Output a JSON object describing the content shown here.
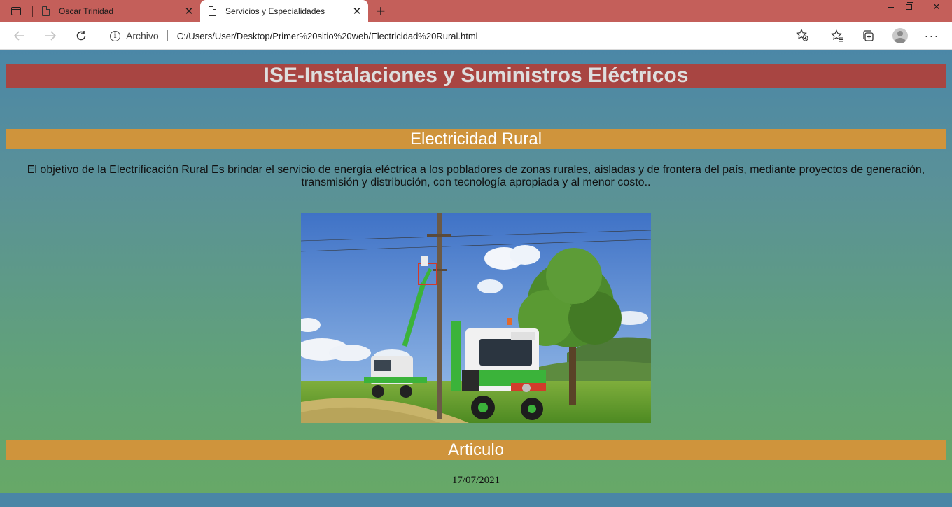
{
  "browser": {
    "tabs": [
      {
        "title": "Oscar Trinidad",
        "active": false
      },
      {
        "title": "Servicios y Especialidades",
        "active": true
      }
    ],
    "new_tab_symbol": "+",
    "address": {
      "site_label": "Archivo",
      "url": "C:/Users/User/Desktop/Primer%20sitio%20web/Electricidad%20Rural.html"
    },
    "icons": [
      "tab-actions-icon",
      "document-icon",
      "close-icon",
      "back-arrow-icon",
      "forward-arrow-icon",
      "reload-icon",
      "info-icon",
      "add-favorite-icon",
      "favorites-icon",
      "collections-icon",
      "profile-avatar",
      "more-menu-icon"
    ]
  },
  "page": {
    "header": "ISE-Instalaciones y Suministros Eléctricos",
    "section_title": "Electricidad Rural",
    "description": "El objetivo de la Electrificación Rural Es brindar el servicio de energía eléctrica a los pobladores de zonas rurales, aisladas y de frontera del país, mediante proyectos de generación, transmisión y distribución, con tecnología apropiada y al menor costo..",
    "image": {
      "subject": "utility trucks with aerial lift repairing a power pole in a green field"
    },
    "article_title": "Articulo",
    "date": "17/07/2021"
  },
  "colors": {
    "tabstrip": "#c45f5a",
    "header_bar": "#a84542",
    "section_bar": "#cf943c",
    "page_bg_top": "#4b87a7",
    "page_bg_bottom": "#67a867"
  }
}
